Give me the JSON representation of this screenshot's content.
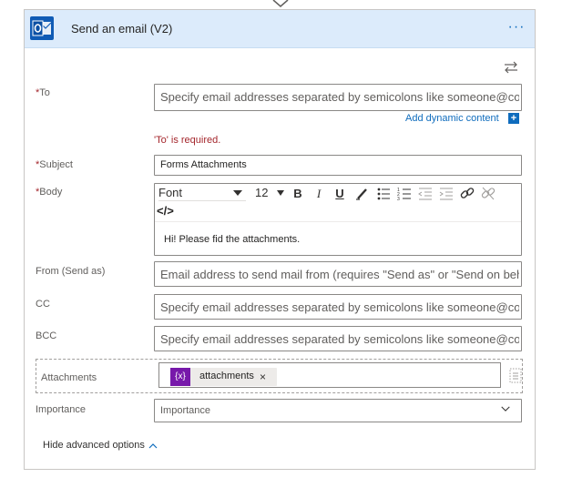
{
  "header": {
    "title": "Send an email (V2)",
    "more_label": "···"
  },
  "fields": {
    "to": {
      "label": "To",
      "required_mark": "*",
      "placeholder": "Specify email addresses separated by semicolons like someone@con",
      "error": "'To' is required."
    },
    "dynamic_content": {
      "label": "Add dynamic content",
      "plus": "+"
    },
    "subject": {
      "label": "Subject",
      "required_mark": "*",
      "value": "Forms Attachments"
    },
    "body": {
      "label": "Body",
      "required_mark": "*",
      "font": "Font",
      "font_size": "12",
      "code_view": "</>",
      "text": "Hi! Please fid the attachments."
    },
    "from": {
      "label": "From (Send as)",
      "placeholder": "Email address to send mail from (requires \"Send as\" or \"Send on beh"
    },
    "cc": {
      "label": "CC",
      "placeholder": "Specify email addresses separated by semicolons like someone@con"
    },
    "bcc": {
      "label": "BCC",
      "placeholder": "Specify email addresses separated by semicolons like someone@con"
    },
    "attachments": {
      "label": "Attachments",
      "token_icon": "{x}",
      "token_label": "attachments",
      "token_remove": "×"
    },
    "importance": {
      "label": "Importance",
      "placeholder": "Importance"
    }
  },
  "toolbar": {
    "bold": "B",
    "italic": "I",
    "underline": "U"
  },
  "footer": {
    "hide_advanced": "Hide advanced options"
  }
}
